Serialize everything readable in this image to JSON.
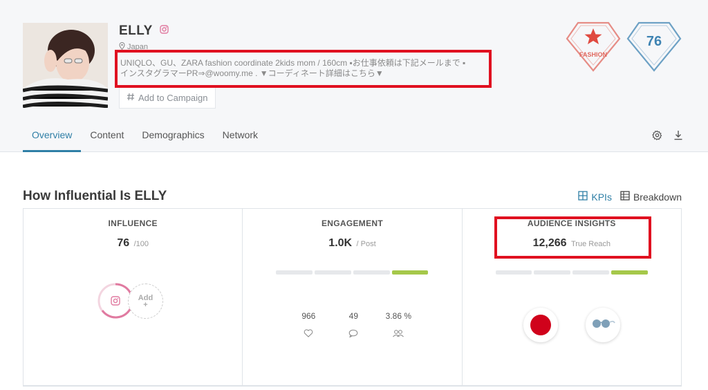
{
  "profile": {
    "name": "ELLY",
    "location": "Japan",
    "bio_line1": "UNIQLO、GU、ZARA fashion coordinate 2kids mom / 160cm ▪お仕事依頼は下記メールまで ▪",
    "bio_line2": "インスタグラマーPR⇒@woomy.me . ▼コーディネート詳細はこちら▼",
    "add_campaign_label": "Add to Campaign"
  },
  "badges": {
    "category_label": "FASHION",
    "score": "76",
    "category_color": "#e0685e",
    "score_color": "#3f84b3"
  },
  "tabs": [
    {
      "label": "Overview",
      "active": true
    },
    {
      "label": "Content",
      "active": false
    },
    {
      "label": "Demographics",
      "active": false
    },
    {
      "label": "Network",
      "active": false
    }
  ],
  "section": {
    "title": "How Influential Is ELLY",
    "toggle_kpis": "KPIs",
    "toggle_breakdown": "Breakdown"
  },
  "cards": {
    "influence": {
      "title": "INFLUENCE",
      "value": "76",
      "unit": "/100",
      "add_label": "Add",
      "add_plus": "+"
    },
    "engagement": {
      "title": "ENGAGEMENT",
      "value": "1.0K",
      "unit": "/ Post",
      "level": 4,
      "level_max": 4,
      "likes": "966",
      "comments": "49",
      "rate": "3.86 %"
    },
    "audience": {
      "title": "AUDIENCE INSIGHTS",
      "value": "12,266",
      "unit": "True Reach",
      "level": 4,
      "level_max": 4
    }
  },
  "colors": {
    "accent": "#2f7fa6",
    "highlight_red": "#e01020",
    "bar_on": "#a5c84a",
    "instagram_pink": "#e07aa0"
  }
}
